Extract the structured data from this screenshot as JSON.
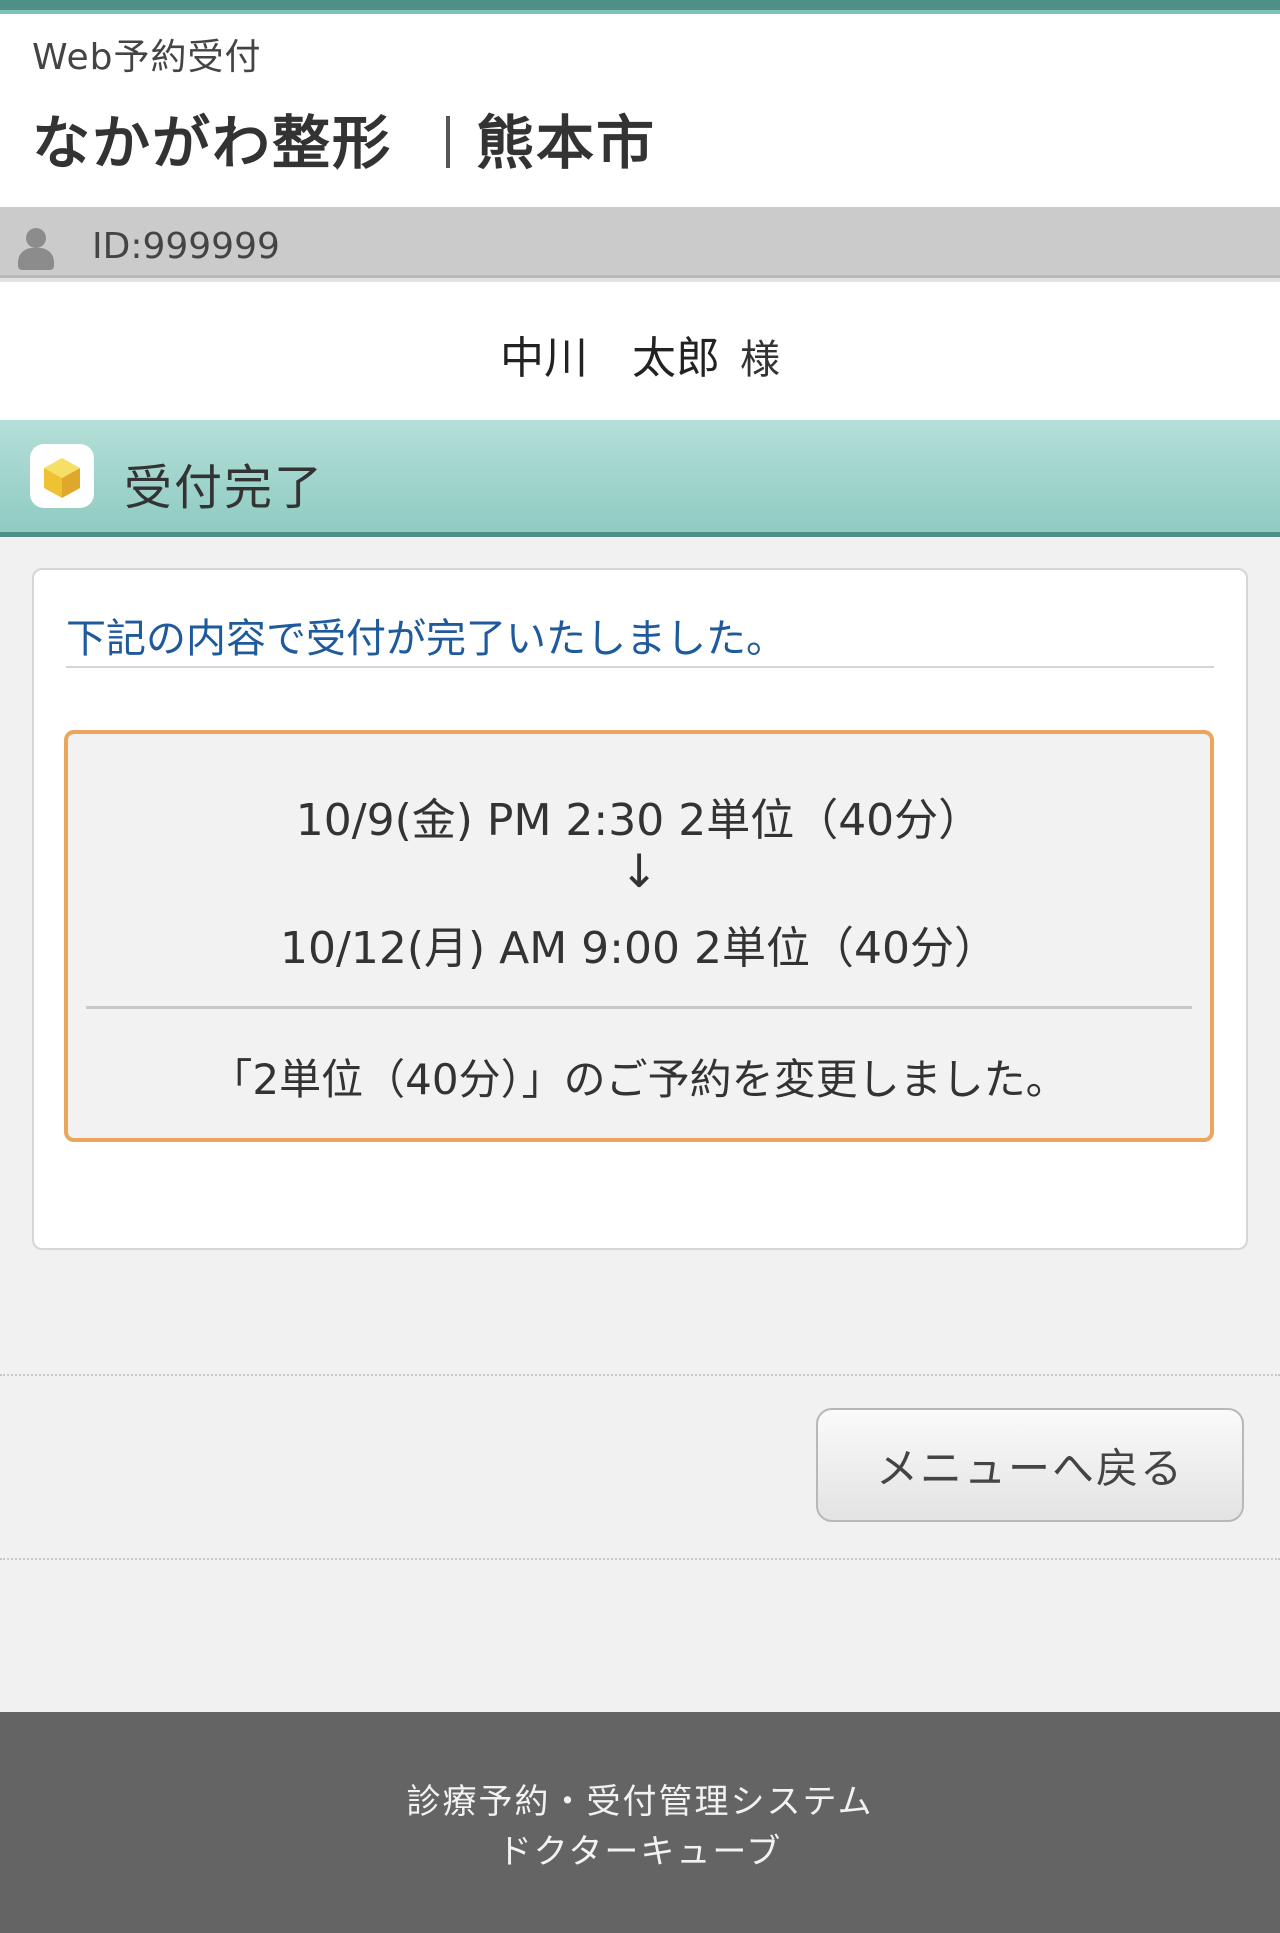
{
  "header": {
    "web_label": "Web予約受付",
    "clinic_name": "なかがわ整形",
    "clinic_city": "熊本市"
  },
  "user": {
    "id_text": "ID:999999",
    "name": "中川　太郎",
    "honorific": "様"
  },
  "section": {
    "title": "受付完了",
    "icon": "cube-icon"
  },
  "card": {
    "message": "下記の内容で受付が完了いたしました。",
    "old_appointment": "10/9(金) PM 2:30 2単位（40分）",
    "arrow": "↓",
    "new_appointment": "10/12(月) AM 9:00 2単位（40分）",
    "change_message": "「2単位（40分）」のご予約を変更しました。"
  },
  "actions": {
    "menu_button": "メニューへ戻る"
  },
  "footer": {
    "line1": "診療予約・受付管理システム",
    "line2": "ドクターキューブ"
  },
  "colors": {
    "accent_teal": "#4e8f86",
    "section_band": "#8fcbc2",
    "box_border": "#eaa65c",
    "message_blue": "#1f5a9c",
    "footer_bg": "#646464"
  }
}
